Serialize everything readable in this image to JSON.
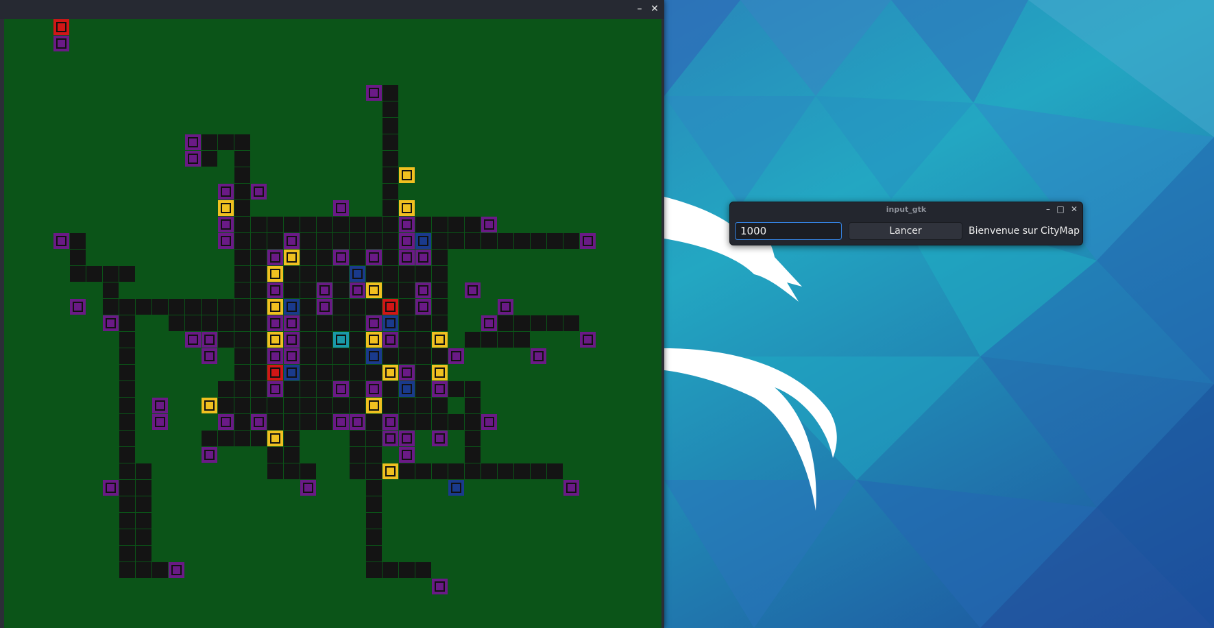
{
  "desktop": {
    "wallpaper": "kali-dragon",
    "colors": {
      "base": "#1e7fb8",
      "light": "#2aa6c6",
      "dark": "#1d5fa6"
    }
  },
  "map_window": {
    "controls": {
      "minimize_icon": "minimize-icon",
      "close_icon": "close-icon",
      "minimize_glyph": "–",
      "close_glyph": "✕"
    },
    "map": {
      "colors": {
        "grass": "#0b5418",
        "road": "#141414",
        "residential": "#6a1a86",
        "commercial": "#f0c020",
        "industrial": "#1a3a8c",
        "fire": "#d11616",
        "park": "#1a9aa8"
      }
    }
  },
  "input_window": {
    "title": "input_gtk",
    "input": {
      "value": "1000"
    },
    "launch_label": "Lancer",
    "welcome_text": "Bienvenue sur CityMap",
    "controls": {
      "minimize_glyph": "–",
      "maximize_glyph": "□",
      "close_glyph": "✕"
    }
  }
}
